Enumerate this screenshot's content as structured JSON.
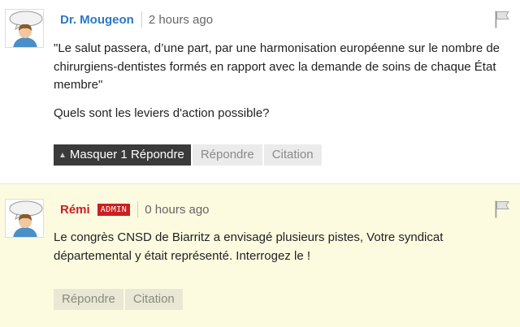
{
  "comments": [
    {
      "author": "Dr. Mougeon",
      "time": "2 hours ago",
      "paragraphs": [
        "\"Le salut passera, d’une part, par une harmonisation européenne sur le nombre de chirurgiens-dentistes formés en rapport avec la demande de soins de chaque État membre\"",
        "Quels sont les leviers d'action possible?"
      ],
      "buttons": {
        "hide_replies": "Masquer 1 Répondre",
        "reply": "Répondre",
        "quote": "Citation"
      }
    },
    {
      "author": "Rémi",
      "badge": "ADMIN",
      "time": "0 hours ago",
      "paragraphs": [
        "Le congrès CNSD de Biarritz a envisagé plusieurs pistes, Votre syndicat départemental y était représenté. Interrogez le !"
      ],
      "buttons": {
        "reply": "Répondre",
        "quote": "Citation"
      }
    }
  ],
  "icons": {
    "avatar": "user-speech-bubble-icon",
    "flag": "flag-icon",
    "arrow": "arrow-up-icon"
  },
  "colors": {
    "author_link": "#2a77c9",
    "admin": "#cc1f1f",
    "highlight_bg": "#fcfbe0"
  }
}
